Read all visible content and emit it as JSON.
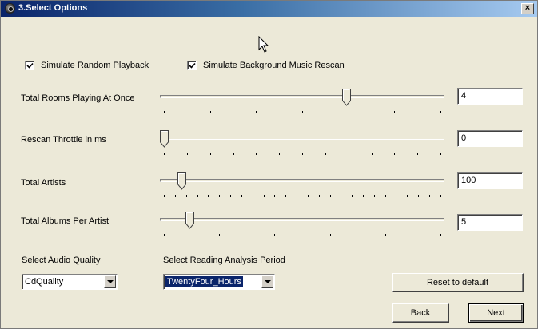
{
  "window": {
    "title": "3.Select Options",
    "close_label": "×"
  },
  "options": {
    "simulate_random_playback": {
      "label": "Simulate Random Playback",
      "checked": true
    },
    "simulate_background_rescan": {
      "label": "Simulate Background Music Rescan",
      "checked": true
    }
  },
  "sliders": [
    {
      "label": "Total Rooms Playing At Once",
      "value": "4",
      "position": 0.66,
      "ticks": 7
    },
    {
      "label": "Rescan Throttle in ms",
      "value": "0",
      "position": 0.0,
      "ticks": 13
    },
    {
      "label": "Total Artists",
      "value": "100",
      "position": 0.065,
      "ticks": 26
    },
    {
      "label": "Total Albums Per Artist",
      "value": "5",
      "position": 0.095,
      "ticks": 6
    }
  ],
  "audio_quality": {
    "label": "Select Audio Quality",
    "selected": "CdQuality"
  },
  "reading_period": {
    "label": "Select Reading Analysis Period",
    "selected": "TwentyFour_Hours"
  },
  "buttons": {
    "reset": "Reset to default",
    "back": "Back",
    "next": "Next"
  }
}
